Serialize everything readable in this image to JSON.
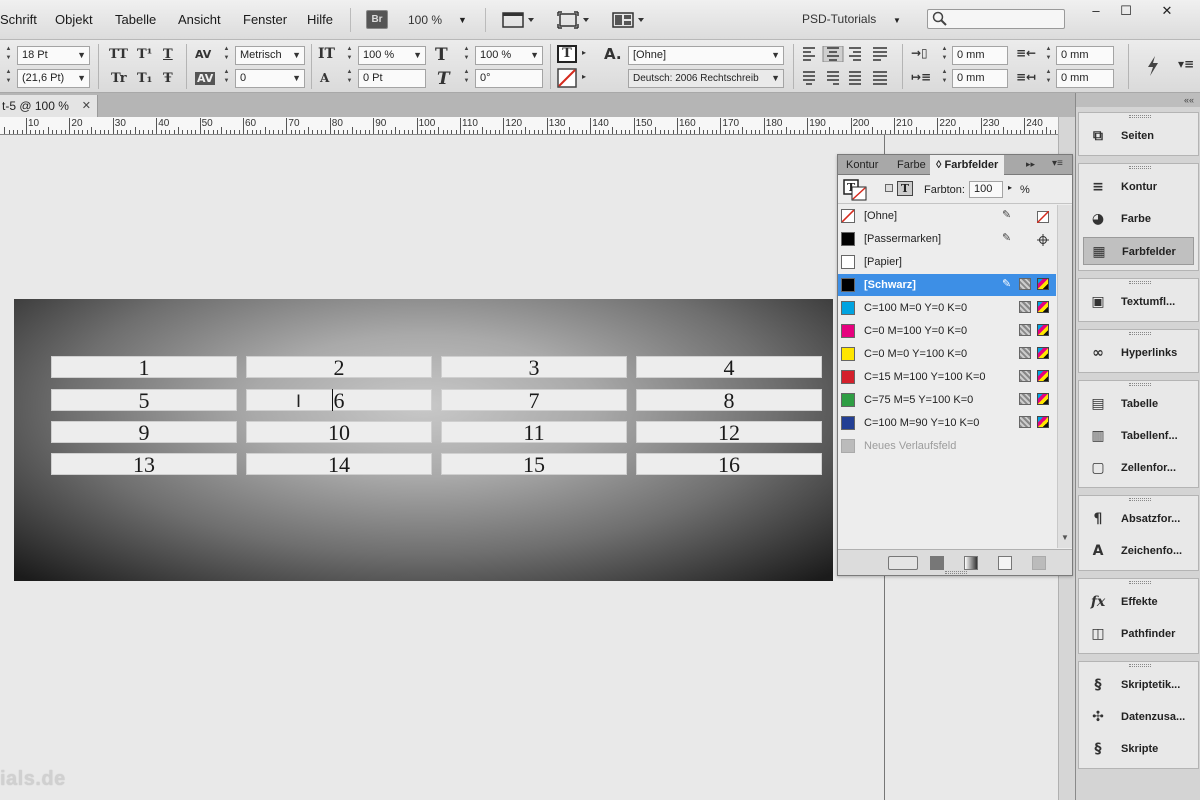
{
  "menubar": {
    "items": [
      "Schrift",
      "Objekt",
      "Tabelle",
      "Ansicht",
      "Fenster",
      "Hilfe"
    ],
    "bridge_label": "Br",
    "zoom": "100 %",
    "workspace": "PSD-Tutorials",
    "window_buttons": [
      "–",
      "☐",
      "✕"
    ]
  },
  "control": {
    "font_size": "18 Pt",
    "leading": "(21,6 Pt)",
    "kerning": "Metrisch",
    "tracking": "0",
    "vscale": "100 %",
    "hscale": "100 %",
    "baseline": "0 Pt",
    "skew": "0°",
    "char_style": "[Ohne]",
    "language": "Deutsch: 2006 Rechtschreib",
    "indent_left": "0 mm",
    "indent_first": "0 mm",
    "indent_right": "0 mm",
    "indent_last": "0 mm",
    "icons": {
      "allcaps": "TT",
      "superscript": "T¹",
      "underline": "T",
      "smallcaps": "Tr",
      "subscript": "T₁",
      "strike": "Ŧ",
      "kern": "AV",
      "track": "AV",
      "vscale": "IT",
      "hscale": "T",
      "baseline": "A",
      "skew": "T",
      "textfill": "T",
      "stroke": "/",
      "char": "A."
    }
  },
  "document": {
    "tab_label": "t-5 @ 100 %",
    "tab_close": "✕",
    "ruler_labels": [
      "10",
      "20",
      "30",
      "40",
      "50",
      "60",
      "70",
      "80",
      "90",
      "100",
      "110",
      "120",
      "130",
      "140",
      "150",
      "160",
      "170",
      "180",
      "190",
      "200",
      "210",
      "220",
      "230",
      "240"
    ],
    "table_rows": [
      [
        "1",
        "2",
        "3",
        "4"
      ],
      [
        "5",
        "6",
        "7",
        "8"
      ],
      [
        "9",
        "10",
        "11",
        "12"
      ],
      [
        "13",
        "14",
        "15",
        "16"
      ]
    ],
    "watermark": "ials.de"
  },
  "swatches_panel": {
    "tabs": [
      "Kontur",
      "Farbe",
      "◊ Farbfelder"
    ],
    "tint_label": "Farbton:",
    "tint_value": "100",
    "tint_unit": "%",
    "swatches": [
      {
        "name": "[Ohne]",
        "color": "none"
      },
      {
        "name": "[Passermarken]",
        "color": "#000000"
      },
      {
        "name": "[Papier]",
        "color": "#ffffff"
      },
      {
        "name": "[Schwarz]",
        "color": "#000000",
        "selected": true
      },
      {
        "name": "C=100 M=0 Y=0 K=0",
        "color": "#00a3e0"
      },
      {
        "name": "C=0 M=100 Y=0 K=0",
        "color": "#e6007e"
      },
      {
        "name": "C=0 M=0 Y=100 K=0",
        "color": "#ffe600"
      },
      {
        "name": "C=15 M=100 Y=100 K=0",
        "color": "#d4202b"
      },
      {
        "name": "C=75 M=5 Y=100 K=0",
        "color": "#2f9e44"
      },
      {
        "name": "C=100 M=90 Y=10 K=0",
        "color": "#233f94"
      },
      {
        "name": "Neues Verlaufsfeld",
        "color": "#bbbbbb",
        "disabled": true
      }
    ],
    "colors": {
      "selected_row": "#3d8fe6"
    }
  },
  "dock": {
    "top_arrows": "««",
    "groups": [
      [
        {
          "label": "Seiten",
          "icon": "pages-icon",
          "glyph": "⧉"
        }
      ],
      [
        {
          "label": "Kontur",
          "icon": "stroke-icon",
          "glyph": "≡"
        },
        {
          "label": "Farbe",
          "icon": "color-icon",
          "glyph": "◕"
        },
        {
          "label": "Farbfelder",
          "icon": "swatches-icon",
          "glyph": "▦",
          "active": true
        }
      ],
      [
        {
          "label": "Textumfl...",
          "icon": "textwrap-icon",
          "glyph": "▣"
        }
      ],
      [
        {
          "label": "Hyperlinks",
          "icon": "hyperlinks-icon",
          "glyph": "∞"
        }
      ],
      [
        {
          "label": "Tabelle",
          "icon": "table-icon",
          "glyph": "▤"
        },
        {
          "label": "Tabellenf...",
          "icon": "table-styles-icon",
          "glyph": "▥"
        },
        {
          "label": "Zellenfor...",
          "icon": "cell-styles-icon",
          "glyph": "▢"
        }
      ],
      [
        {
          "label": "Absatzfor...",
          "icon": "paragraph-styles-icon",
          "glyph": "¶"
        },
        {
          "label": "Zeichenfo...",
          "icon": "character-styles-icon",
          "glyph": "A"
        }
      ],
      [
        {
          "label": "Effekte",
          "icon": "effects-icon",
          "glyph": "fx"
        },
        {
          "label": "Pathfinder",
          "icon": "pathfinder-icon",
          "glyph": "◫"
        }
      ],
      [
        {
          "label": "Skriptetik...",
          "icon": "script-label-icon",
          "glyph": "§"
        },
        {
          "label": "Datenzusa...",
          "icon": "data-merge-icon",
          "glyph": "✣"
        },
        {
          "label": "Skripte",
          "icon": "scripts-icon",
          "glyph": "§"
        }
      ]
    ]
  }
}
